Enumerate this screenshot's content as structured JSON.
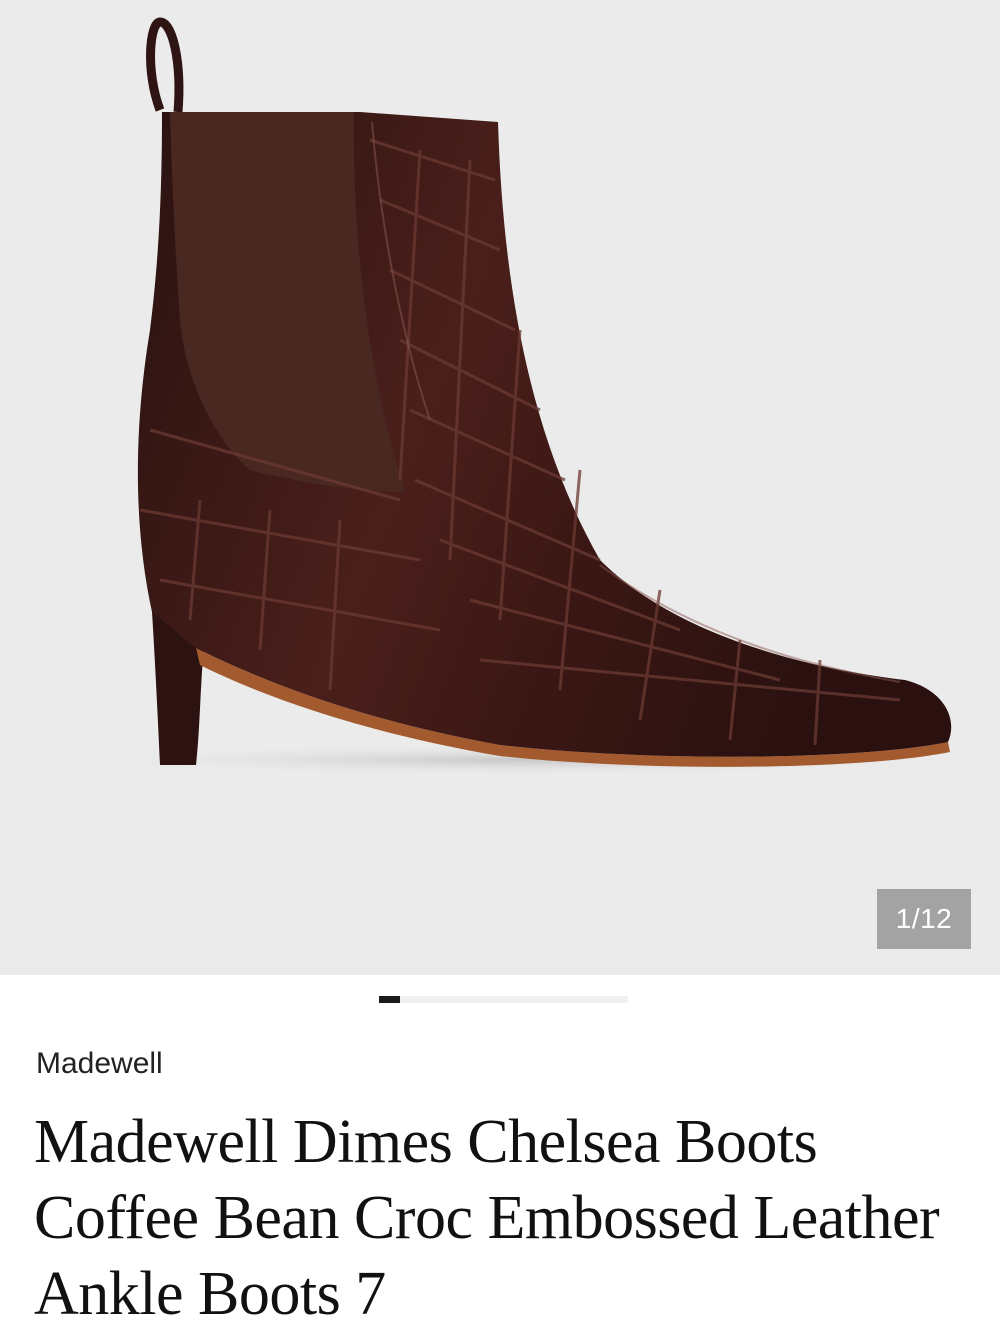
{
  "gallery": {
    "image_alt": "Coffee bean croc embossed leather chelsea ankle boot",
    "counter": "1/12",
    "current_index": 1,
    "total_images": 12
  },
  "product": {
    "brand": "Madewell",
    "title": "Madewell Dimes Chelsea Boots Coffee Bean Croc Embossed Leather Ankle Boots 7"
  },
  "colors": {
    "gallery_bg": "#ebebeb",
    "leather": "#3b1a17",
    "elastic": "#4a2822",
    "sole": "#a35a2e",
    "counter_bg": "#a3a3a3"
  }
}
